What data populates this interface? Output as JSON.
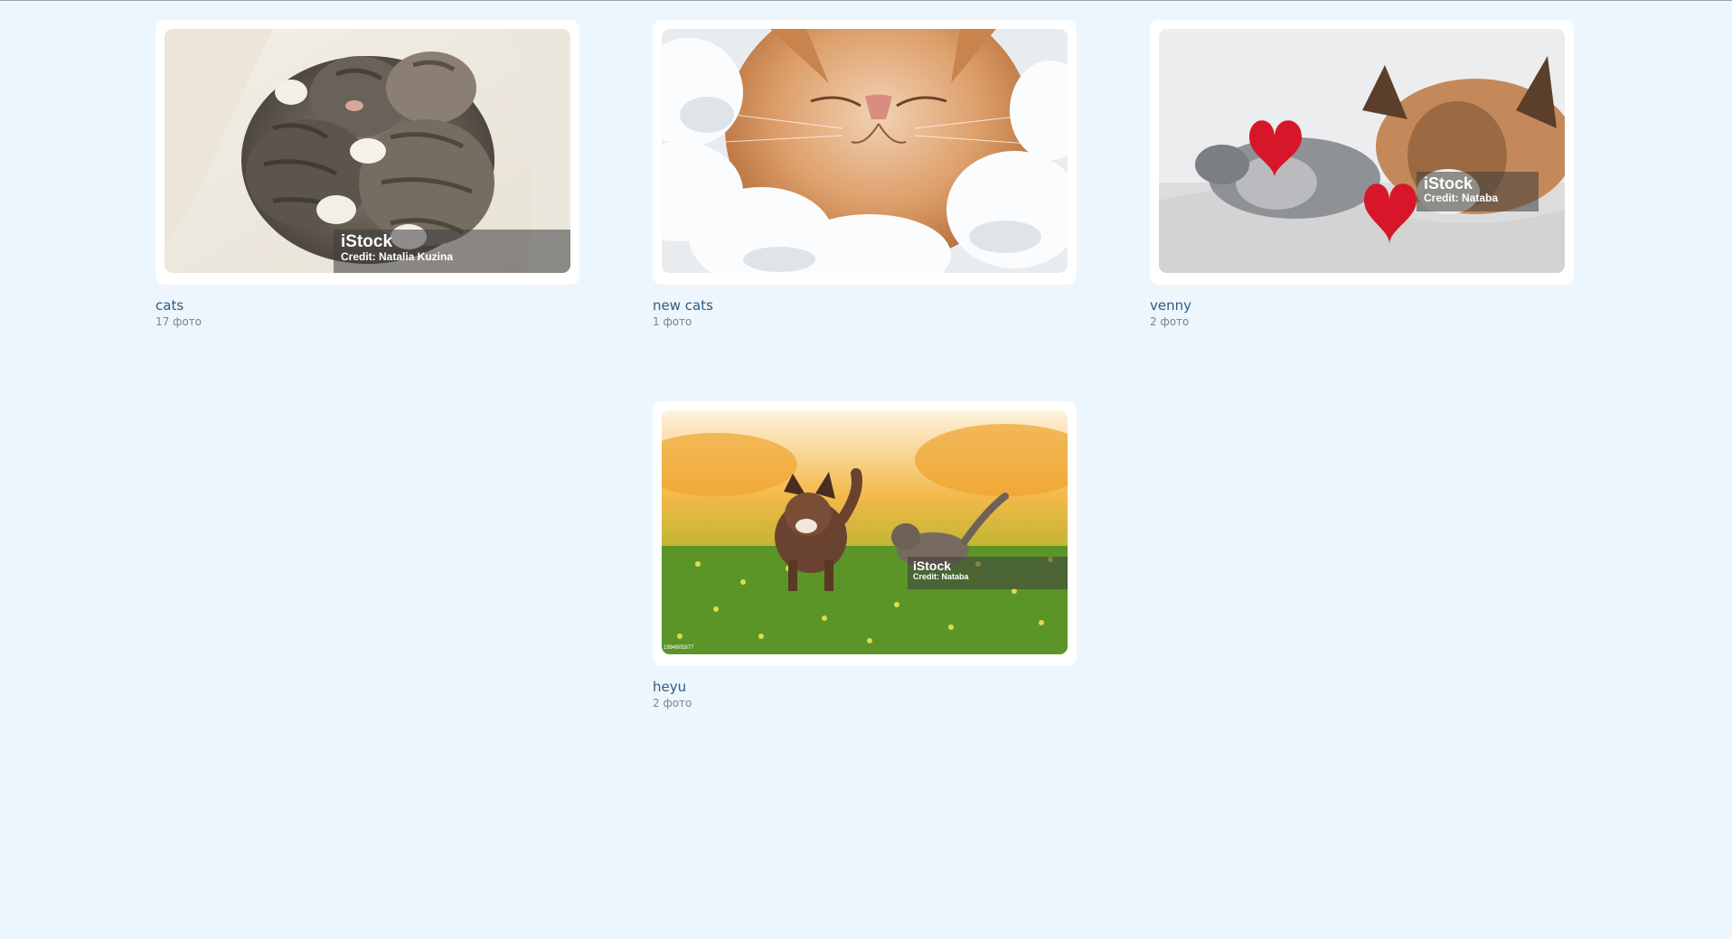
{
  "albums": [
    {
      "title": "cats",
      "count": "17 фото",
      "watermark": {
        "brand": "iStock",
        "credit": "Credit: Natalia Kuzina"
      }
    },
    {
      "title": "new cats",
      "count": "1 фото"
    },
    {
      "title": "venny",
      "count": "2 фото",
      "watermark": {
        "brand": "iStock",
        "credit": "Credit: Nataba"
      }
    },
    {
      "title": "heyu",
      "count": "2 фото",
      "watermark": {
        "brand": "iStock",
        "credit": "Credit: Nataba"
      },
      "image_id": "1994905977"
    }
  ],
  "colors": {
    "page_background": "#edf6fd",
    "card_background": "#ffffff",
    "title_color": "#2d5b86",
    "count_color": "#7a848d"
  }
}
